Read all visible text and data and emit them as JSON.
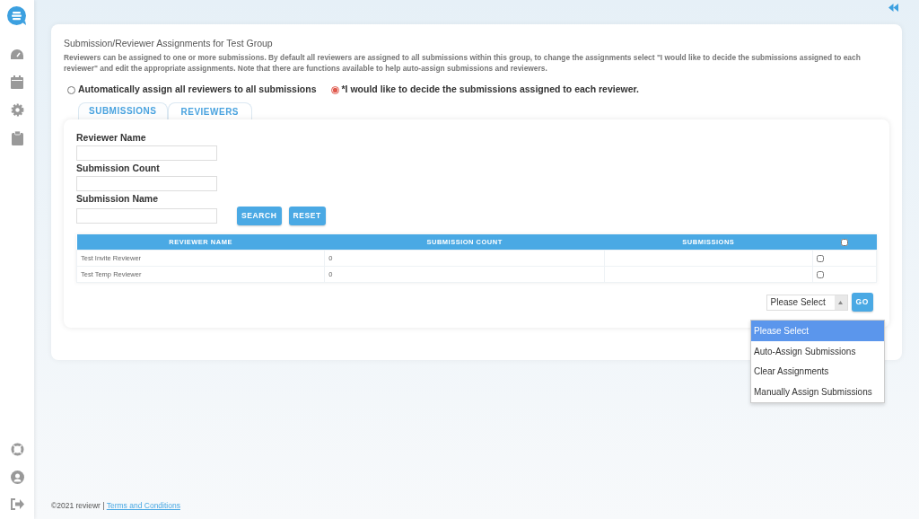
{
  "header": {
    "title": "Submission/Reviewer Assignments for Test Group",
    "description": "Reviewers can be assigned to one or more submissions. By default all reviewers are assigned to all submissions within this group, to change the assignments select \"I would like to decide the submissions assigned to each reviewer\" and edit the appropriate assignments. Note that there are functions available to help auto-assign submissions and reviewers."
  },
  "assignment_modes": [
    {
      "label": "Automatically assign all reviewers to all submissions",
      "selected": false
    },
    {
      "label": "*I would like to decide the submissions assigned to each reviewer.",
      "selected": true
    }
  ],
  "tabs": [
    {
      "label": "SUBMISSIONS",
      "selected": false
    },
    {
      "label": "REVIEWERS",
      "selected": true
    }
  ],
  "filters": [
    {
      "label": "Reviewer Name"
    },
    {
      "label": "Submission Count"
    },
    {
      "label": "Submission Name"
    }
  ],
  "buttons": [
    "SEARCH",
    "RESET"
  ],
  "table": {
    "columns": [
      "REVIEWER NAME",
      "SUBMISSION COUNT",
      "SUBMISSIONS"
    ],
    "select_all_checked": false,
    "rows": [
      {
        "reviewer_name": "Test Invite Reviewer",
        "submission_count": "0",
        "checked": false
      },
      {
        "reviewer_name": "Test Temp Reviewer",
        "submission_count": "0",
        "checked": false
      }
    ]
  },
  "action": {
    "value": "Please Select",
    "go": "GO",
    "expanded": true,
    "options": [
      {
        "label": "Please Select",
        "selected": true
      },
      {
        "label": "Auto-Assign Submissions",
        "selected": false
      },
      {
        "label": "Clear Assignments",
        "selected": false
      },
      {
        "label": "Manually Assign Submissions",
        "selected": false
      }
    ]
  },
  "footer": {
    "copyright": "©2021 reviewr |",
    "link": "Terms and Conditions"
  }
}
